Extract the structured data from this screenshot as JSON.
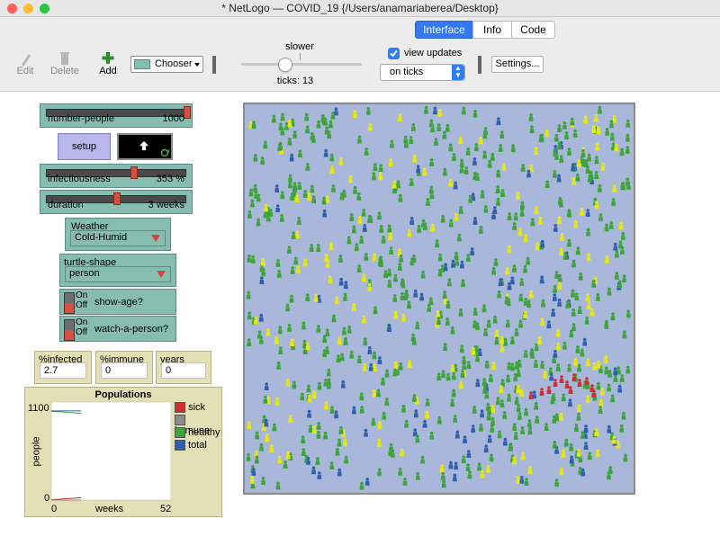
{
  "window": {
    "title": "* NetLogo — COVID_19 {/Users/anamariaberea/Desktop}"
  },
  "toolbar": {
    "edit_label": "Edit",
    "delete_label": "Delete",
    "add_label": "Add",
    "chooser_widget_label": "Chooser",
    "speed_label": "slower",
    "ticks_label": "ticks: 13",
    "view_updates_label": "view updates",
    "view_updates_checked": true,
    "update_mode": "on ticks",
    "settings_label": "Settings...",
    "tabs": [
      "Interface",
      "Info",
      "Code"
    ],
    "active_tab": "Interface"
  },
  "widgets": {
    "number_people": {
      "label": "number-people",
      "value": "1000"
    },
    "setup_label": "setup",
    "infectiousness": {
      "label": "infectiousness",
      "value": "353 %"
    },
    "duration": {
      "label": "duration",
      "value": "3 weeks"
    },
    "weather": {
      "label": "Weather",
      "value": "Cold-Humid"
    },
    "turtle_shape": {
      "label": "turtle-shape",
      "value": "person"
    },
    "show_age": {
      "label": "show-age?",
      "on": "On",
      "off": "Off"
    },
    "watch_person": {
      "label": "watch-a-person?",
      "on": "On",
      "off": "Off"
    },
    "monitors": [
      {
        "label": "%infected",
        "value": "2.7"
      },
      {
        "label": "%immune",
        "value": "0"
      },
      {
        "label": "years",
        "value": "0"
      }
    ]
  },
  "chart_data": {
    "type": "line",
    "title": "Populations",
    "xlabel": "weeks",
    "ylabel": "people",
    "xlim": [
      0,
      52
    ],
    "ylim": [
      0,
      1100
    ],
    "x_ticks": [
      "0",
      "52"
    ],
    "y_ticks": [
      "0",
      "1100"
    ],
    "series": [
      {
        "name": "sick",
        "color": "#d62b2b",
        "x": [
          0,
          4,
          8,
          13
        ],
        "y": [
          5,
          10,
          18,
          27
        ]
      },
      {
        "name": "immune",
        "color": "#8c8c8c",
        "x": [
          0,
          4,
          8,
          13
        ],
        "y": [
          0,
          0,
          0,
          0
        ]
      },
      {
        "name": "healthy",
        "color": "#3ea33e",
        "x": [
          0,
          4,
          8,
          13
        ],
        "y": [
          995,
          990,
          982,
          973
        ]
      },
      {
        "name": "total",
        "color": "#2f5fae",
        "x": [
          0,
          4,
          8,
          13
        ],
        "y": [
          1000,
          1000,
          1000,
          1000
        ]
      }
    ]
  },
  "colors": {
    "world_bg": "#a9b8da",
    "healthy": "#3ea33e",
    "immune": "#e8e80c",
    "total_blue": "#2f5fae",
    "sick": "#d62b2b"
  }
}
